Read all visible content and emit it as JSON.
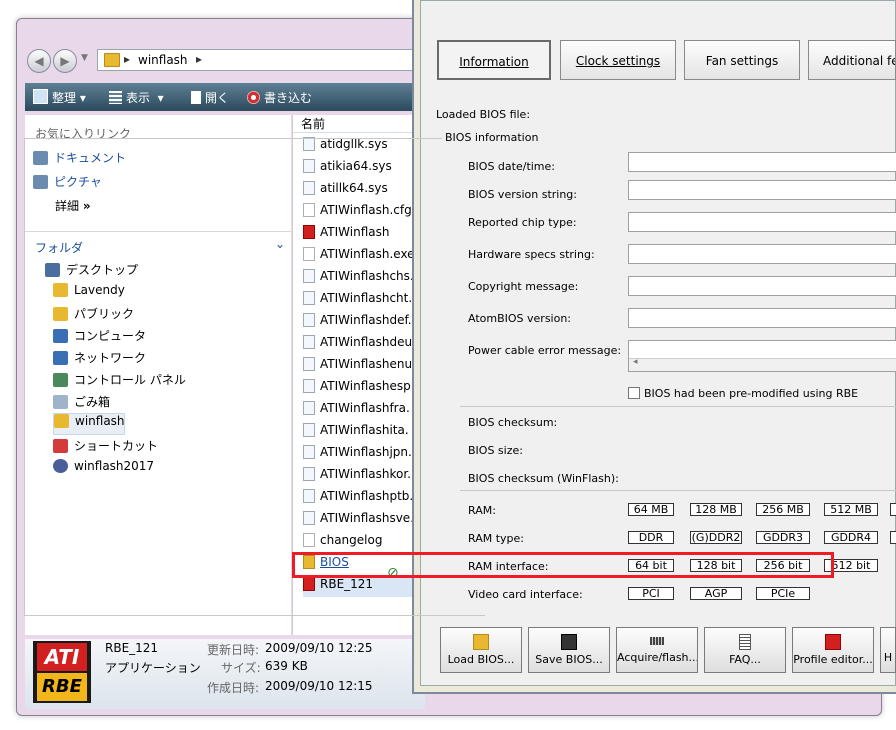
{
  "explorer": {
    "address": {
      "path": "winflash"
    },
    "toolbar": {
      "organize": "整理",
      "view": "表示",
      "open": "開く",
      "burn": "書き込む"
    },
    "nav": {
      "favorites_header": "お気に入りリンク",
      "favorites": [
        "ドキュメント",
        "ピクチャ"
      ],
      "more": "詳細",
      "more_chevron": "»",
      "folders_header": "フォルダ",
      "tree": [
        "デスクトップ",
        "Lavendy",
        "パブリック",
        "コンピュータ",
        "ネットワーク",
        "コントロール パネル",
        "ごみ箱",
        "winflash",
        "ショートカット",
        "winflash2017"
      ]
    },
    "list_header": "名前",
    "files": [
      "atidgllk.sys",
      "atikia64.sys",
      "atillk64.sys",
      "ATIWinflash.cfg",
      "ATIWinflash",
      "ATIWinflash.exe",
      "ATIWinflashchs.",
      "ATIWinflashcht.",
      "ATIWinflashdef.",
      "ATIWinflashdeu.",
      "ATIWinflashenu.",
      "ATIWinflashesp.",
      "ATIWinflashfra.",
      "ATIWinflashita.",
      "ATIWinflashjpn.",
      "ATIWinflashkor.",
      "ATIWinflashptb.",
      "ATIWinflashsve.",
      "changelog",
      "BIOS",
      "RBE_121"
    ],
    "details": {
      "logo_top": "ATI",
      "logo_bottom": "RBE",
      "name": "RBE_121",
      "type": "アプリケーション",
      "modified_label": "更新日時:",
      "modified": "2009/09/10 12:25",
      "size_label": "サイズ:",
      "size": "639 KB",
      "created_label": "作成日時:",
      "created": "2009/09/10 12:15"
    }
  },
  "rbe": {
    "tabs": [
      "Information",
      "Clock settings",
      "Fan settings",
      "Additional featu"
    ],
    "loaded_bios": "Loaded BIOS file:",
    "group_title": "BIOS information",
    "fields": [
      "BIOS date/time:",
      "BIOS version string:",
      "Reported chip type:",
      "Hardware specs string:",
      "Copyright message:",
      "AtomBIOS version:",
      "Power cable error message:"
    ],
    "scroll_arrow": "◂",
    "premodified": "BIOS had been pre-modified using RBE",
    "checksum_labels": [
      "BIOS checksum:",
      "BIOS size:",
      "BIOS checksum (WinFlash):"
    ],
    "ram_label": "RAM:",
    "ram": [
      "64 MB",
      "128 MB",
      "256 MB",
      "512 MB"
    ],
    "ram_type_label": "RAM type:",
    "ram_type": [
      "DDR",
      "(G)DDR2",
      "GDDR3",
      "GDDR4"
    ],
    "ram_interface_label": "RAM interface:",
    "ram_interface": [
      "64 bit",
      "128 bit",
      "256 bit",
      "512 bit"
    ],
    "video_if_label": "Video card interface:",
    "video_if": [
      "PCI",
      "AGP",
      "PCIe"
    ],
    "buttons": [
      "Load BIOS...",
      "Save BIOS...",
      "Acquire/flash...",
      "FAQ...",
      "Profile editor...",
      "H"
    ]
  }
}
